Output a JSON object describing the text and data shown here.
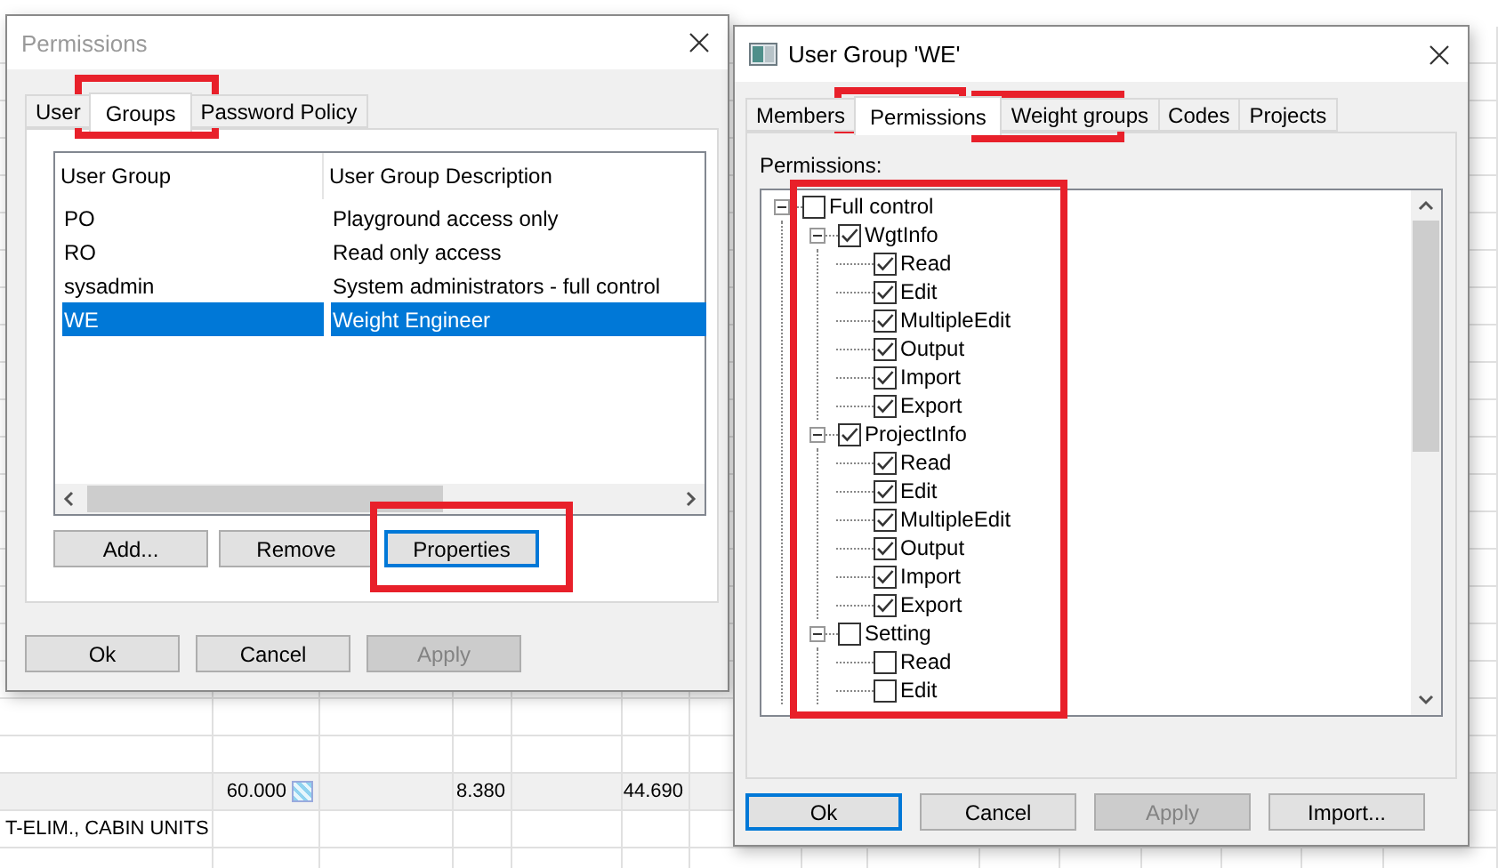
{
  "sheet": {
    "rows": [
      {
        "kind": "total",
        "column_2": "60.000",
        "column_4": "8.380",
        "column_6": "44.690"
      },
      {
        "kind": "text",
        "column_1": "T-ELIM., CABIN UNITS"
      }
    ]
  },
  "permissions_dialog": {
    "title": "Permissions",
    "active": false,
    "tabs": [
      {
        "label": "User",
        "selected": false
      },
      {
        "label": "Groups",
        "selected": true
      },
      {
        "label": "Password Policy",
        "selected": false
      }
    ],
    "table": {
      "columns": [
        "User Group",
        "User Group Description"
      ],
      "rows": [
        {
          "cells": [
            "PO",
            "Playground access only"
          ],
          "selected": false
        },
        {
          "cells": [
            "RO",
            "Read only access"
          ],
          "selected": false
        },
        {
          "cells": [
            "sysadmin",
            "System administrators - full control"
          ],
          "selected": false
        },
        {
          "cells": [
            "WE",
            "Weight Engineer"
          ],
          "selected": true
        }
      ]
    },
    "list_buttons": [
      {
        "label": "Add...",
        "focused": false,
        "disabled": false
      },
      {
        "label": "Remove",
        "focused": false,
        "disabled": false
      },
      {
        "label": "Properties",
        "focused": true,
        "disabled": false
      }
    ],
    "buttons": [
      {
        "label": "Ok",
        "focused": false,
        "disabled": false
      },
      {
        "label": "Cancel",
        "focused": false,
        "disabled": false
      },
      {
        "label": "Apply",
        "focused": false,
        "disabled": true
      }
    ]
  },
  "group_dialog": {
    "title": "User Group 'WE'",
    "active": true,
    "tabs": [
      {
        "label": "Members",
        "selected": false
      },
      {
        "label": "Permissions",
        "selected": true
      },
      {
        "label": "Weight groups",
        "selected": false
      },
      {
        "label": "Codes",
        "selected": false
      },
      {
        "label": "Projects",
        "selected": false
      }
    ],
    "permissions_label": "Permissions:",
    "tree": [
      {
        "label": "Full control",
        "checked": false,
        "expanded": true,
        "children": [
          {
            "label": "WgtInfo",
            "checked": true,
            "expanded": true,
            "children": [
              {
                "label": "Read",
                "checked": true
              },
              {
                "label": "Edit",
                "checked": true
              },
              {
                "label": "MultipleEdit",
                "checked": true
              },
              {
                "label": "Output",
                "checked": true
              },
              {
                "label": "Import",
                "checked": true
              },
              {
                "label": "Export",
                "checked": true
              }
            ]
          },
          {
            "label": "ProjectInfo",
            "checked": true,
            "expanded": true,
            "children": [
              {
                "label": "Read",
                "checked": true
              },
              {
                "label": "Edit",
                "checked": true
              },
              {
                "label": "MultipleEdit",
                "checked": true
              },
              {
                "label": "Output",
                "checked": true
              },
              {
                "label": "Import",
                "checked": true
              },
              {
                "label": "Export",
                "checked": true
              }
            ]
          },
          {
            "label": "Setting",
            "checked": false,
            "expanded": true,
            "children": [
              {
                "label": "Read",
                "checked": false
              },
              {
                "label": "Edit",
                "checked": false
              }
            ]
          }
        ]
      }
    ],
    "buttons": [
      {
        "label": "Ok",
        "focused": true,
        "disabled": false
      },
      {
        "label": "Cancel",
        "focused": false,
        "disabled": false
      },
      {
        "label": "Apply",
        "focused": false,
        "disabled": true
      },
      {
        "label": "Import...",
        "focused": false,
        "disabled": false
      }
    ]
  }
}
